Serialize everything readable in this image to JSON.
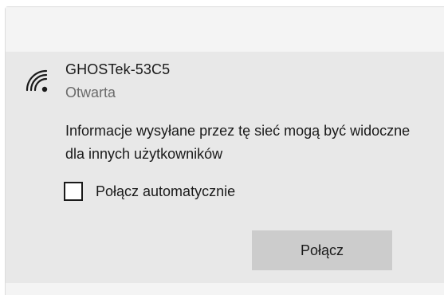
{
  "network": {
    "ssid": "GHOSTek-53C5",
    "status": "Otwarta",
    "icon": "wifi-signal-icon",
    "warning": "Informacje wysyłane przez tę sieć mogą być widoczne dla innych użytkowników",
    "auto_connect_label": "Połącz automatycznie",
    "auto_connect_checked": false,
    "connect_label": "Połącz"
  },
  "colors": {
    "item_background": "#e8e8e8",
    "button_background": "#cccccc",
    "secondary_text": "#6b6b6b"
  }
}
